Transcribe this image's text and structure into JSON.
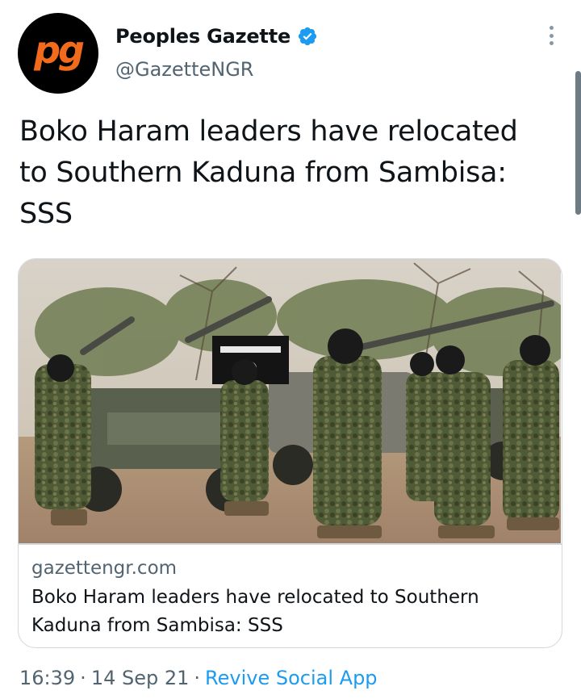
{
  "author": {
    "avatar_text": "pg",
    "display_name": "Peoples Gazette",
    "handle": "@GazetteNGR",
    "verified": true,
    "avatar_bg": "#000000",
    "avatar_accent": "#f26a1b"
  },
  "tweet": {
    "text": "Boko Haram leaders have relocated to Southern Kaduna from Sambisa: SSS"
  },
  "card": {
    "image_icon": "militants-with-trucks-photo",
    "domain": "gazettengr.com",
    "title": "Boko Haram leaders have relocated to Southern Kaduna from Sambisa: SSS"
  },
  "meta": {
    "time": "16:39",
    "date": "14 Sep 21",
    "separator": "·",
    "source": "Revive Social App"
  },
  "icons": {
    "verified": "verified-badge-icon",
    "more": "more-options-icon"
  },
  "colors": {
    "link": "#1d9bf0",
    "secondary_text": "#536471",
    "border": "#cfd9de",
    "verified": "#1d9bf0"
  }
}
